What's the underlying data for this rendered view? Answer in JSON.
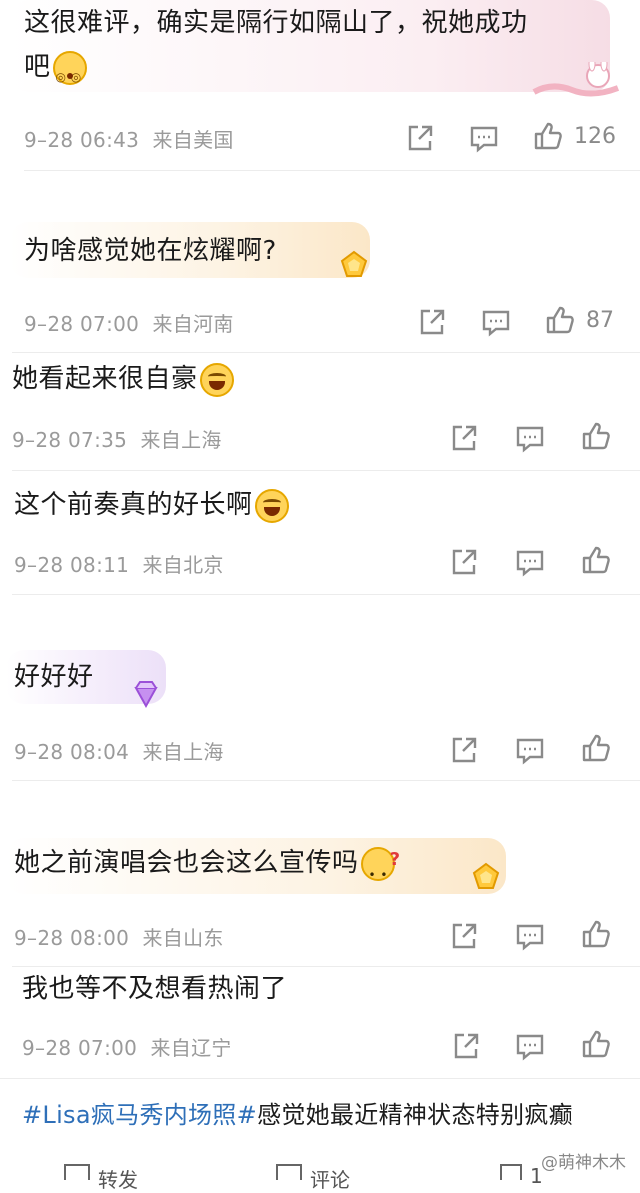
{
  "comments": [
    {
      "text": "这很难评，确实是隔行如隔山了，祝她成功",
      "text2": "吧",
      "time": "9–28 06:43",
      "location": "来自美国",
      "likes": "126"
    },
    {
      "text": "为啥感觉她在炫耀啊?",
      "time": "9–28 07:00",
      "location": "来自河南",
      "likes": "87"
    },
    {
      "text": "她看起来很自豪",
      "time": "9–28 07:35",
      "location": "来自上海",
      "likes": ""
    },
    {
      "text": "这个前奏真的好长啊",
      "time": "9–28 08:11",
      "location": "来自北京",
      "likes": ""
    },
    {
      "text": "好好好",
      "time": "9–28 08:04",
      "location": "来自上海",
      "likes": ""
    },
    {
      "text": "她之前演唱会也会这么宣传吗",
      "time": "9–28 08:00",
      "location": "来自山东",
      "likes": ""
    },
    {
      "text": "我也等不及想看热闹了",
      "time": "9–28 07:00",
      "location": "来自辽宁",
      "likes": ""
    }
  ],
  "hashtag": {
    "tag": "#Lisa疯马秀内场照#",
    "rest": "感觉她最近精神状态特别疯癫"
  },
  "footer": {
    "repost": "转发",
    "comment": "评论",
    "like_count": "1",
    "watermark": "@萌神木木"
  },
  "colors": {
    "accent": "#2e6fb8",
    "meta": "#9a9a9a"
  }
}
